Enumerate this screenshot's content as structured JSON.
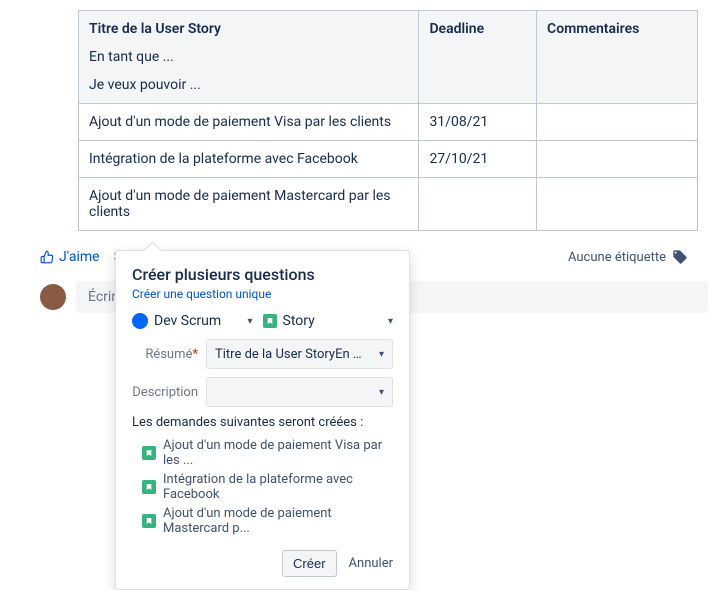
{
  "table": {
    "header": {
      "c1_title": "Titre de la User Story",
      "c1_l2": "En tant que ...",
      "c1_l3": "Je veux pouvoir ...",
      "c2": "Deadline",
      "c3": "Commentaires"
    },
    "rows": [
      {
        "title": "Ajout d'un mode de paiement Visa par les clients",
        "deadline": "31/08/21",
        "comment": ""
      },
      {
        "title": "Intégration de la plateforme avec Facebook",
        "deadline": "27/10/21",
        "comment": ""
      },
      {
        "title": "Ajout d'un mode de paiement Mastercard par les clients",
        "deadline": "",
        "comment": ""
      }
    ]
  },
  "actions": {
    "like": "J'aime",
    "watch_prefix": "So",
    "no_labels": "Aucune étiquette"
  },
  "comment": {
    "placeholder": "Écrire "
  },
  "popover": {
    "title": "Créer plusieurs questions",
    "link": "Créer une question unique",
    "project": "Dev Scrum",
    "issuetype": "Story",
    "fields": {
      "summary_label": "Résumé",
      "summary_value": "Titre de la User StoryEn tant ...",
      "description_label": "Description",
      "description_value": ""
    },
    "list_intro": "Les demandes suivantes seront créées :",
    "issues": [
      "Ajout d'un mode de paiement Visa par les ...",
      "Intégration de la plateforme avec Facebook",
      "Ajout d'un mode de paiement Mastercard p..."
    ],
    "create": "Créer",
    "cancel": "Annuler"
  }
}
